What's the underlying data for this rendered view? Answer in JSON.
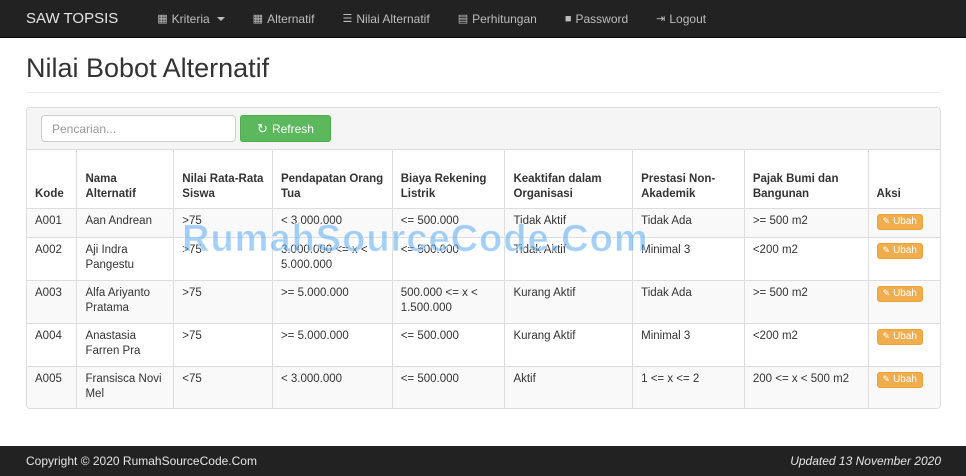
{
  "navbar": {
    "brand": "SAW TOPSIS",
    "items": [
      {
        "label": "Kriteria",
        "icon": "th-large-icon",
        "dropdown": true
      },
      {
        "label": "Alternatif",
        "icon": "th-icon"
      },
      {
        "label": "Nilai Alternatif",
        "icon": "th-list-icon"
      },
      {
        "label": "Perhitungan",
        "icon": "calendar-icon"
      },
      {
        "label": "Password",
        "icon": "lock-icon"
      },
      {
        "label": "Logout",
        "icon": "logout-icon"
      }
    ]
  },
  "page": {
    "title": "Nilai Bobot Alternatif"
  },
  "toolbar": {
    "search_placeholder": "Pencarian...",
    "refresh_label": "Refresh"
  },
  "table": {
    "headers": [
      "Kode",
      "Nama Alternatif",
      "Nilai Rata-Rata Siswa",
      "Pendapatan Orang Tua",
      "Biaya Rekening Listrik",
      "Keaktifan dalam Organisasi",
      "Prestasi Non-Akademik",
      "Pajak Bumi dan Bangunan",
      "Aksi"
    ],
    "action_label": "Ubah",
    "rows": [
      {
        "kode": "A001",
        "nama": "Aan Andrean",
        "nilai": ">75",
        "pendapatan": "< 3.000.000",
        "biaya": "<= 500.000",
        "keaktifan": "Tidak Aktif",
        "prestasi": "Tidak Ada",
        "pajak": ">= 500 m2"
      },
      {
        "kode": "A002",
        "nama": "Aji Indra Pangestu",
        "nilai": ">75",
        "pendapatan": "3.000.000 <= x < 5.000.000",
        "biaya": "<= 500.000",
        "keaktifan": "Tidak Aktif",
        "prestasi": "Minimal 3",
        "pajak": "<200 m2"
      },
      {
        "kode": "A003",
        "nama": "Alfa Ariyanto Pratama",
        "nilai": ">75",
        "pendapatan": ">= 5.000.000",
        "biaya": "500.000 <= x < 1.500.000",
        "keaktifan": "Kurang Aktif",
        "prestasi": "Tidak Ada",
        "pajak": ">= 500 m2"
      },
      {
        "kode": "A004",
        "nama": "Anastasia Farren Pra",
        "nilai": ">75",
        "pendapatan": ">= 5.000.000",
        "biaya": "<= 500.000",
        "keaktifan": "Kurang Aktif",
        "prestasi": "Minimal 3",
        "pajak": "<200 m2"
      },
      {
        "kode": "A005",
        "nama": "Fransisca Novi Mel",
        "nilai": "<75",
        "pendapatan": "< 3.000.000",
        "biaya": "<= 500.000",
        "keaktifan": "Aktif",
        "prestasi": "1 <= x <= 2",
        "pajak": "200 <= x < 500 m2"
      }
    ]
  },
  "watermark": "RumahSourceCode.Com",
  "footer": {
    "copyright": "Copyright © 2020 RumahSourceCode.Com",
    "updated": "Updated 13 November 2020"
  },
  "colors": {
    "navbar_bg": "#222222",
    "success": "#5cb85c",
    "warning": "#f0ad4e"
  }
}
